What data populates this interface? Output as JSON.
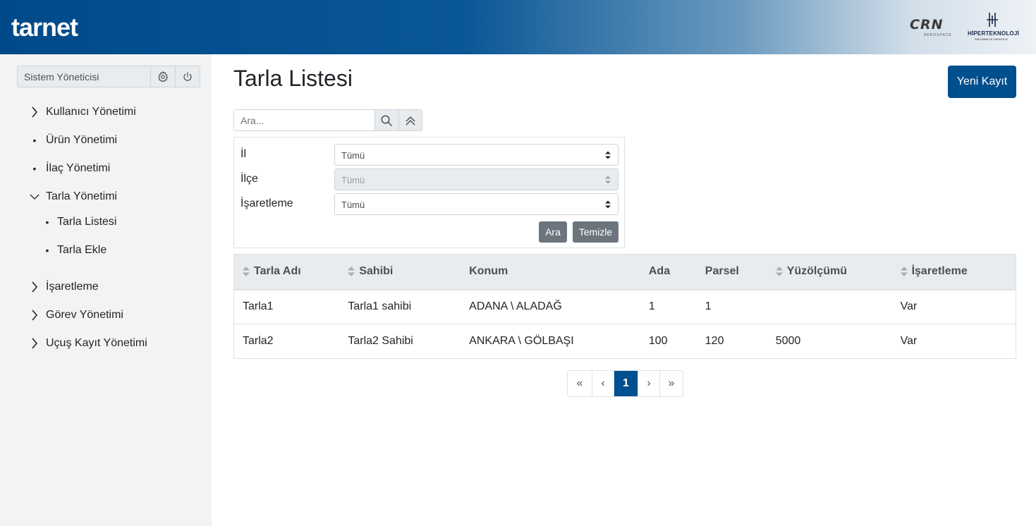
{
  "header": {
    "brand": "tarnet",
    "partner_logo_1": {
      "name": "CRN",
      "sub": "AEROSPACE"
    },
    "partner_logo_2": {
      "name": "HİPERTEKNOLOJİ",
      "sub": "SAVUNMA VE HAVACILIK"
    }
  },
  "sidebar": {
    "user": "Sistem Yöneticisi",
    "items": [
      {
        "label": "Kullanıcı Yönetimi",
        "marker": "chevron-right"
      },
      {
        "label": "Ürün Yönetimi",
        "marker": "dot"
      },
      {
        "label": "İlaç Yönetimi",
        "marker": "dot"
      },
      {
        "label": "Tarla Yönetimi",
        "marker": "chevron-down"
      },
      {
        "label": "Tarla Listesi",
        "marker": "dot",
        "sub": true
      },
      {
        "label": "Tarla Ekle",
        "marker": "dot",
        "sub": true
      },
      {
        "label": "İşaretleme",
        "marker": "chevron-right"
      },
      {
        "label": "Görev Yönetimi",
        "marker": "chevron-right"
      },
      {
        "label": "Uçuş Kayıt Yönetimi",
        "marker": "chevron-right"
      }
    ]
  },
  "main": {
    "title": "Tarla Listesi",
    "new_button": "Yeni Kayıt",
    "search_placeholder": "Ara...",
    "filters": {
      "il": {
        "label": "İl",
        "value": "Tümü"
      },
      "ilce": {
        "label": "İlçe",
        "value": "Tümü"
      },
      "isaretleme": {
        "label": "İşaretleme",
        "value": "Tümü"
      },
      "search_button": "Ara",
      "clear_button": "Temizle"
    },
    "table": {
      "columns": [
        {
          "label": "Tarla Adı",
          "sortable": true
        },
        {
          "label": "Sahibi",
          "sortable": true
        },
        {
          "label": "Konum",
          "sortable": false
        },
        {
          "label": "Ada",
          "sortable": false
        },
        {
          "label": "Parsel",
          "sortable": false
        },
        {
          "label": "Yüzölçümü",
          "sortable": true
        },
        {
          "label": "İşaretleme",
          "sortable": true
        }
      ],
      "rows": [
        [
          "Tarla1",
          "Tarla1 sahibi",
          "ADANA \\ ALADAĞ",
          "1",
          "1",
          "",
          "Var"
        ],
        [
          "Tarla2",
          "Tarla2 Sahibi",
          "ANKARA \\ GÖLBAŞI",
          "100",
          "120",
          "5000",
          "Var"
        ]
      ]
    },
    "pagination": {
      "first": "«",
      "prev": "‹",
      "current": "1",
      "next": "›",
      "last": "»"
    }
  }
}
